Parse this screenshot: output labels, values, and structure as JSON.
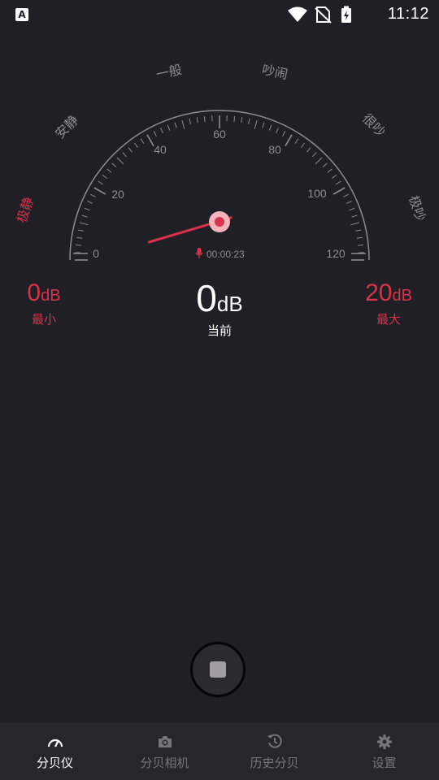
{
  "status_bar": {
    "time": "11:12",
    "icons": [
      "a-notification-icon",
      "wifi-icon",
      "no-sim-icon",
      "battery-charging-icon"
    ]
  },
  "gauge": {
    "zone_labels": [
      "极静",
      "安静",
      "一般",
      "吵闹",
      "很吵",
      "极吵"
    ],
    "scale_min": 0,
    "scale_max": 120,
    "tick_labels": [
      "0",
      "20",
      "40",
      "60",
      "80",
      "100",
      "120"
    ],
    "needle_value": 20,
    "elapsed_time": "00:00:23",
    "colors": {
      "accent": "#d8334a",
      "muted": "#8e8c93",
      "background": "#211f26"
    }
  },
  "readouts": {
    "min": {
      "value": "0",
      "unit": "dB",
      "label": "最小"
    },
    "current": {
      "value": "0",
      "unit": "dB",
      "label": "当前"
    },
    "max": {
      "value": "20",
      "unit": "dB",
      "label": "最大"
    }
  },
  "bottom_nav": {
    "items": [
      {
        "label": "分贝仪",
        "icon": "gauge-icon",
        "active": true
      },
      {
        "label": "分贝相机",
        "icon": "camera-icon",
        "active": false
      },
      {
        "label": "历史分贝",
        "icon": "history-icon",
        "active": false
      },
      {
        "label": "设置",
        "icon": "settings-icon",
        "active": false
      }
    ]
  }
}
